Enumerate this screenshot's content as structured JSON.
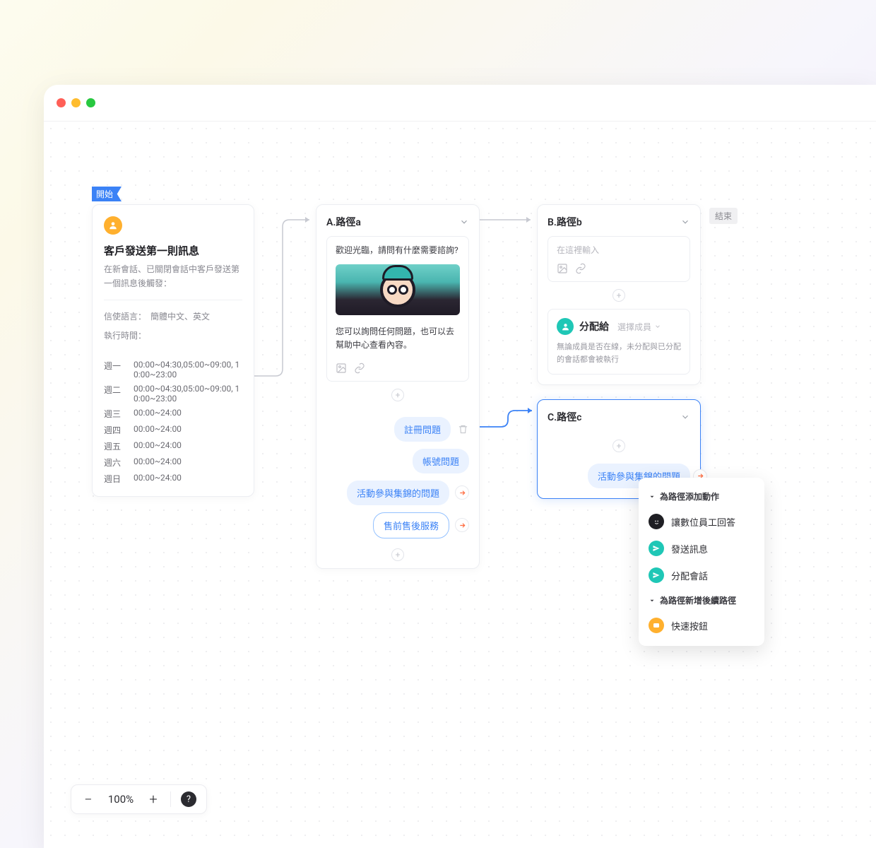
{
  "labels": {
    "start": "開始",
    "end": "結束"
  },
  "trigger": {
    "title": "客戶發送第一則訊息",
    "desc": "在新會話、已關閉會話中客戶發送第一個訊息後觸發：",
    "lang_label": "信使語言：",
    "lang_value": "簡體中文、英文",
    "time_label": "執行時間：",
    "schedule": [
      {
        "day": "週一",
        "time": "00:00~04:30,05:00~09:00, 10:00~23:00"
      },
      {
        "day": "週二",
        "time": "00:00~04:30,05:00~09:00, 10:00~23:00"
      },
      {
        "day": "週三",
        "time": "00:00~24:00"
      },
      {
        "day": "週四",
        "time": "00:00~24:00"
      },
      {
        "day": "週五",
        "time": "00:00~24:00"
      },
      {
        "day": "週六",
        "time": "00:00~24:00"
      },
      {
        "day": "週日",
        "time": "00:00~24:00"
      }
    ]
  },
  "pathA": {
    "title": "A.路徑a",
    "greeting": "歡迎光臨，請問有什麼需要諮詢?",
    "body": "您可以詢問任何問題，也可以去幫助中心查看內容。",
    "chips": [
      {
        "label": "註冊問題",
        "trash": true,
        "arrow": false
      },
      {
        "label": "帳號問題",
        "trash": false,
        "arrow": false
      },
      {
        "label": "活動參與集錦的問題",
        "trash": false,
        "arrow": true
      },
      {
        "label": "售前售後服務",
        "trash": false,
        "arrow": true,
        "outline": true
      }
    ]
  },
  "pathB": {
    "title": "B.路徑b",
    "placeholder": "在這裡輸入",
    "assign": {
      "title": "分配給",
      "select": "選擇成員",
      "desc": "無論成員是否在線，未分配與已分配的會話都會被執行"
    }
  },
  "pathC": {
    "title": "C.路徑c",
    "chip": "活動參與集錦的問題"
  },
  "popup": {
    "section1": "為路徑添加動作",
    "items1": [
      {
        "icon": "black",
        "label": "讓數位員工回答"
      },
      {
        "icon": "teal",
        "label": "發送訊息"
      },
      {
        "icon": "teal",
        "label": "分配會話"
      }
    ],
    "section2": "為路徑新增後續路徑",
    "items2": [
      {
        "icon": "orange",
        "label": "快速按鈕"
      }
    ]
  },
  "zoom": {
    "value": "100%"
  }
}
